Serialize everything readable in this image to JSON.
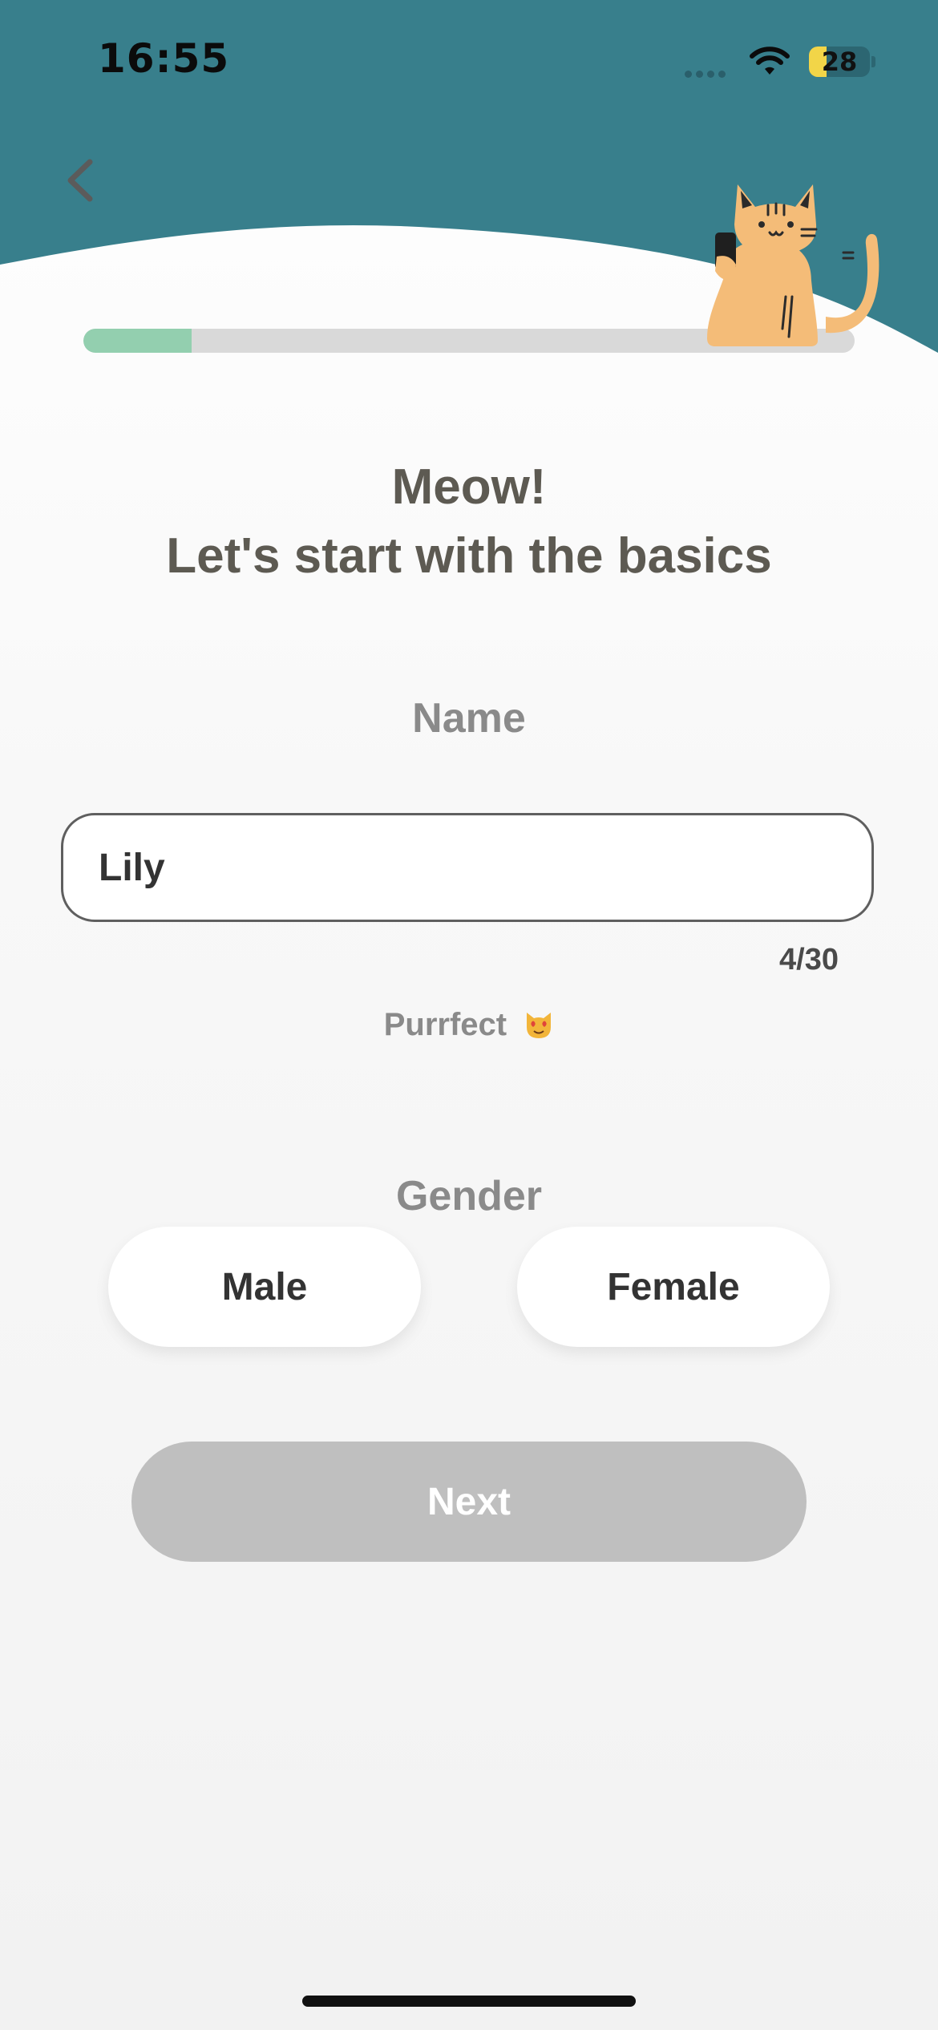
{
  "status_bar": {
    "time": "16:55",
    "battery_level": "28",
    "battery_fraction": 0.28
  },
  "colors": {
    "header": "#387f8c",
    "progress_fill": "#93cfaf",
    "title_text": "#5d5a52",
    "next_disabled": "#bfbfbf"
  },
  "icons": {
    "back": "chevron-left-icon",
    "mascot": "cat-with-phone-icon",
    "hint_emoji": "heart-eyes-cat-emoji"
  },
  "progress": {
    "fraction": 0.14
  },
  "title": {
    "line1": "Meow!",
    "line2": "Let's start with the basics"
  },
  "name_section": {
    "label": "Name",
    "value": "Lily",
    "counter": "4/30",
    "hint": "Purrfect"
  },
  "gender_section": {
    "label": "Gender",
    "options": [
      "Male",
      "Female"
    ]
  },
  "next_button": {
    "label": "Next",
    "enabled": false
  }
}
